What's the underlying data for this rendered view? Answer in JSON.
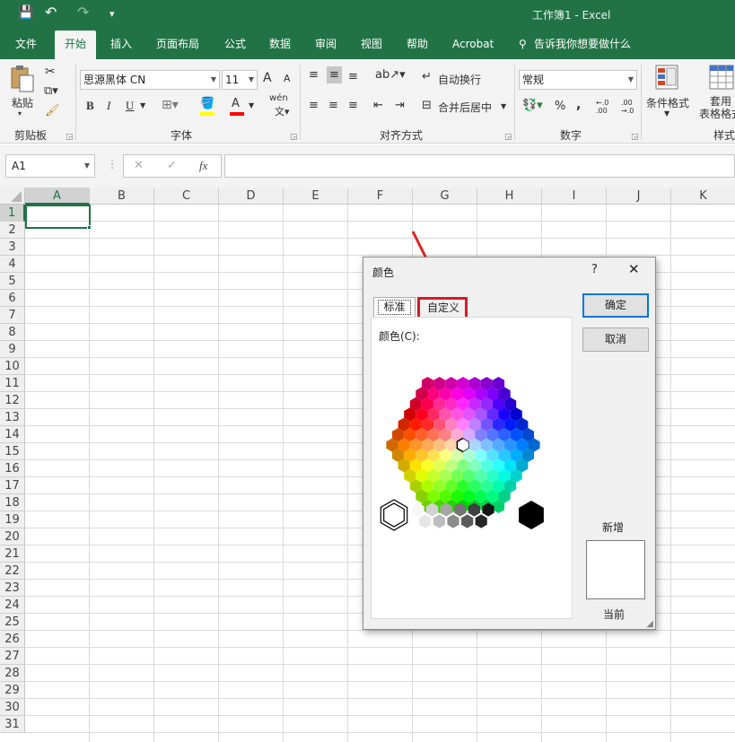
{
  "window": {
    "title": "工作簿1  -  Excel"
  },
  "quick_access": {
    "save": "💾",
    "undo": "↶",
    "redo": "↷",
    "customize": "▾"
  },
  "menu": {
    "items": [
      "文件",
      "开始",
      "插入",
      "页面布局",
      "公式",
      "数据",
      "审阅",
      "视图",
      "帮助",
      "Acrobat",
      "告诉我你想要做什么"
    ],
    "active_index": 1
  },
  "ribbon": {
    "clipboard": {
      "paste": "粘贴",
      "label": "剪贴板"
    },
    "font": {
      "name": "思源黑体 CN",
      "size": "11",
      "grow": "A",
      "shrink": "A",
      "bold": "B",
      "italic": "I",
      "underline": "U",
      "wen": "wén",
      "label": "字体"
    },
    "alignment": {
      "wrap": "自动换行",
      "merge": "合并后居中",
      "label": "对齐方式"
    },
    "number": {
      "format": "常规",
      "percent": "%",
      "comma": ",",
      "inc": "←.0 .00",
      "dec": ".00 →.0",
      "label": "数字"
    },
    "styles": {
      "cond": "条件格式",
      "table": "套用\n表格格式",
      "label": "样式"
    }
  },
  "formula_bar": {
    "name_box": "A1",
    "cancel": "✕",
    "enter": "✓",
    "fx": "fx",
    "value": ""
  },
  "sheet": {
    "columns": [
      "A",
      "B",
      "C",
      "D",
      "E",
      "F",
      "G",
      "H",
      "I",
      "J",
      "K"
    ],
    "rows": [
      "1",
      "2",
      "3",
      "4",
      "5",
      "6",
      "7",
      "8",
      "9",
      "10",
      "11",
      "12",
      "13",
      "14",
      "15",
      "16",
      "17",
      "18",
      "19",
      "20",
      "21",
      "22",
      "23",
      "24",
      "25",
      "26",
      "27",
      "28",
      "29",
      "30",
      "31"
    ],
    "selected_cell": "A1"
  },
  "dialog": {
    "title": "颜色",
    "help": "?",
    "close": "✕",
    "tabs": [
      "标准",
      "自定义"
    ],
    "active_tab": 0,
    "colors_label": "颜色(C):",
    "ok": "确定",
    "cancel": "取消",
    "new_label": "新增",
    "current_label": "当前",
    "current_color": "#ffffff"
  },
  "colors": {
    "excel_green": "#217346",
    "highlight_red": "#d7182a",
    "arrow_red": "#e02424"
  }
}
